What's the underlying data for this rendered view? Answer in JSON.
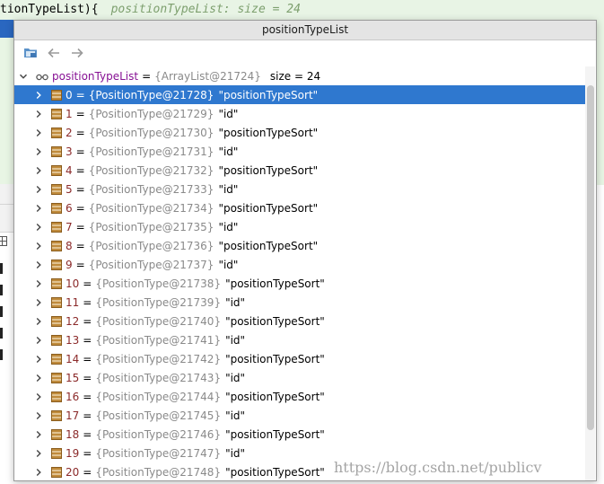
{
  "editor": {
    "code": "tionTypeList){",
    "hint": "positionTypeList:  size = 24"
  },
  "popup": {
    "title": "positionTypeList",
    "toolbar": {
      "icons": [
        "folder-icon",
        "back-arrow-icon",
        "forward-arrow-icon"
      ]
    },
    "root": {
      "name": "positionTypeList",
      "type": "{ArrayList@21724}",
      "size_label": "size = 24",
      "icon": "watch-glasses-icon"
    },
    "selected_index": 0,
    "items": [
      {
        "index": "0",
        "type": "{PositionType@21728}",
        "value": "\"positionTypeSort\""
      },
      {
        "index": "1",
        "type": "{PositionType@21729}",
        "value": "\"id\""
      },
      {
        "index": "2",
        "type": "{PositionType@21730}",
        "value": "\"positionTypeSort\""
      },
      {
        "index": "3",
        "type": "{PositionType@21731}",
        "value": "\"id\""
      },
      {
        "index": "4",
        "type": "{PositionType@21732}",
        "value": "\"positionTypeSort\""
      },
      {
        "index": "5",
        "type": "{PositionType@21733}",
        "value": "\"id\""
      },
      {
        "index": "6",
        "type": "{PositionType@21734}",
        "value": "\"positionTypeSort\""
      },
      {
        "index": "7",
        "type": "{PositionType@21735}",
        "value": "\"id\""
      },
      {
        "index": "8",
        "type": "{PositionType@21736}",
        "value": "\"positionTypeSort\""
      },
      {
        "index": "9",
        "type": "{PositionType@21737}",
        "value": "\"id\""
      },
      {
        "index": "10",
        "type": "{PositionType@21738}",
        "value": "\"positionTypeSort\""
      },
      {
        "index": "11",
        "type": "{PositionType@21739}",
        "value": "\"id\""
      },
      {
        "index": "12",
        "type": "{PositionType@21740}",
        "value": "\"positionTypeSort\""
      },
      {
        "index": "13",
        "type": "{PositionType@21741}",
        "value": "\"id\""
      },
      {
        "index": "14",
        "type": "{PositionType@21742}",
        "value": "\"positionTypeSort\""
      },
      {
        "index": "15",
        "type": "{PositionType@21743}",
        "value": "\"id\""
      },
      {
        "index": "16",
        "type": "{PositionType@21744}",
        "value": "\"positionTypeSort\""
      },
      {
        "index": "17",
        "type": "{PositionType@21745}",
        "value": "\"id\""
      },
      {
        "index": "18",
        "type": "{PositionType@21746}",
        "value": "\"positionTypeSort\""
      },
      {
        "index": "19",
        "type": "{PositionType@21747}",
        "value": "\"id\""
      },
      {
        "index": "20",
        "type": "{PositionType@21748}",
        "value": "\"positionTypeSort\""
      }
    ]
  },
  "watermark": "https://blog.csdn.net/publicv",
  "colors": {
    "selection": "#2f78cf",
    "index_text": "#8b2a2a",
    "type_text": "#8a8a8a",
    "field_icon": "#b07a2a",
    "editor_bg": "#e8f5e4"
  }
}
